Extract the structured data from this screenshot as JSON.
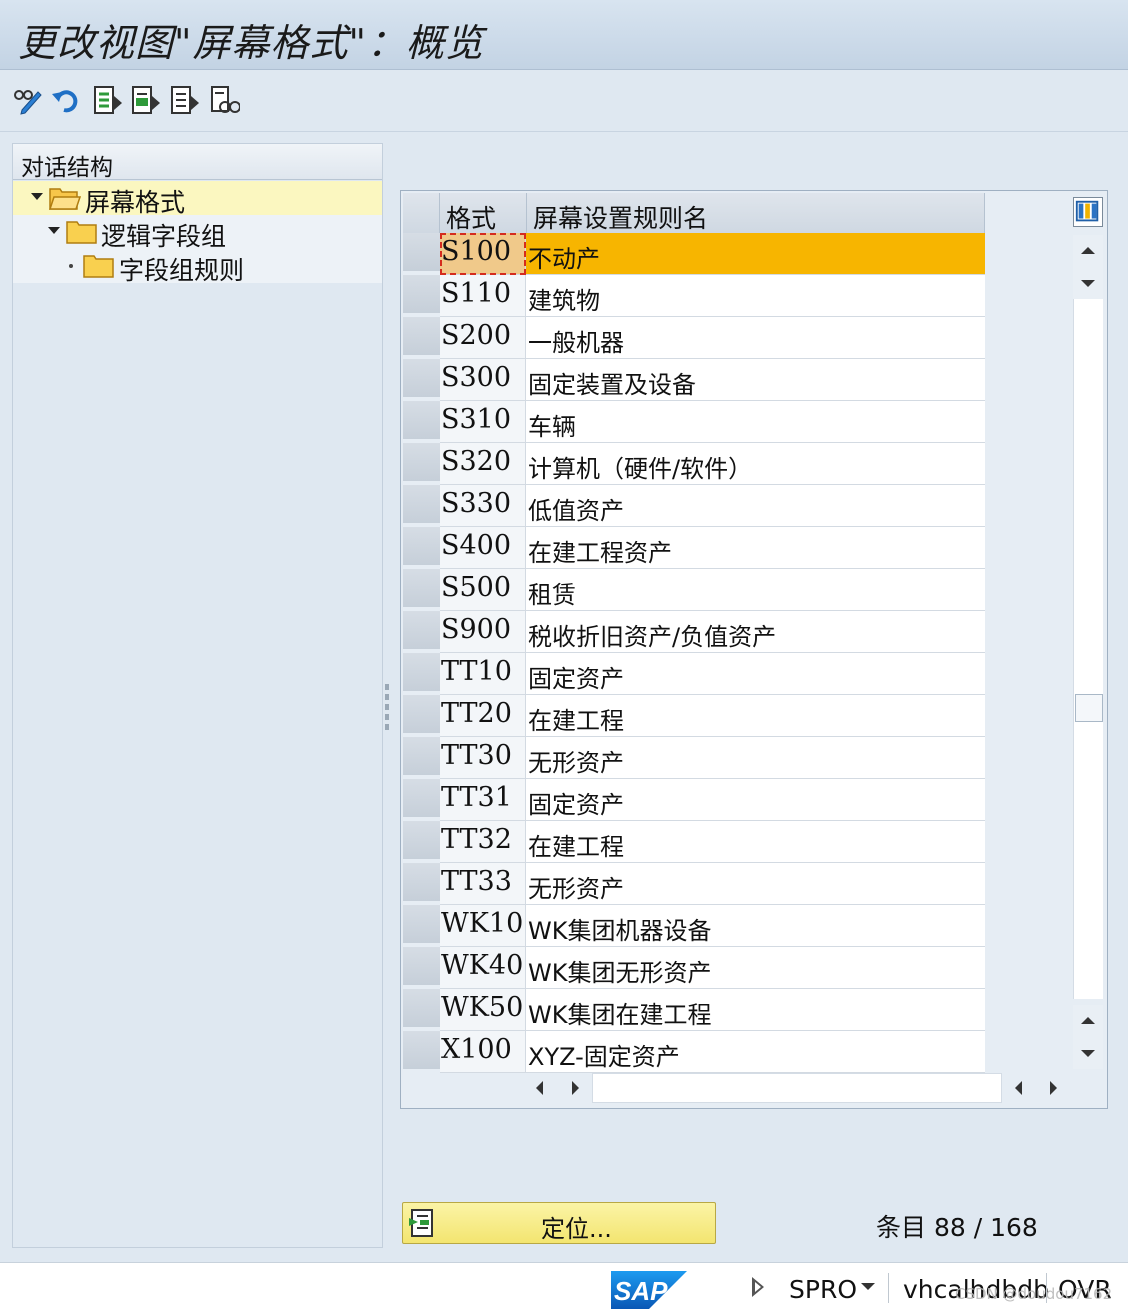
{
  "window": {
    "title": "更改视图\"屏幕格式\"：概览"
  },
  "toolbar": {
    "buttons": [
      {
        "name": "display-change-icon"
      },
      {
        "name": "undo-icon"
      },
      {
        "name": "select-all-icon"
      },
      {
        "name": "select-block-icon"
      },
      {
        "name": "deselect-all-icon"
      },
      {
        "name": "print-icon"
      }
    ]
  },
  "dialog_structure": {
    "header": "对话结构",
    "items": [
      {
        "label": "屏幕格式",
        "level": 0,
        "expanded": true,
        "selected": true
      },
      {
        "label": "逻辑字段组",
        "level": 1,
        "expanded": true,
        "selected": false
      },
      {
        "label": "字段组规则",
        "level": 2,
        "expanded": false,
        "selected": false
      }
    ]
  },
  "table": {
    "columns": [
      "格式",
      "屏幕设置规则名"
    ],
    "rows": [
      {
        "code": "S100",
        "name": "不动产",
        "highlighted": true
      },
      {
        "code": "S110",
        "name": "建筑物"
      },
      {
        "code": "S200",
        "name": "一般机器"
      },
      {
        "code": "S300",
        "name": "固定装置及设备"
      },
      {
        "code": "S310",
        "name": "车辆"
      },
      {
        "code": "S320",
        "name": "计算机（硬件/软件）"
      },
      {
        "code": "S330",
        "name": "低值资产"
      },
      {
        "code": "S400",
        "name": "在建工程资产"
      },
      {
        "code": "S500",
        "name": "租赁"
      },
      {
        "code": "S900",
        "name": "税收折旧资产/负值资产"
      },
      {
        "code": "TT10",
        "name": "固定资产"
      },
      {
        "code": "TT20",
        "name": "在建工程"
      },
      {
        "code": "TT30",
        "name": "无形资产"
      },
      {
        "code": "TT31",
        "name": "固定资产"
      },
      {
        "code": "TT32",
        "name": "在建工程"
      },
      {
        "code": "TT33",
        "name": "无形资产"
      },
      {
        "code": "WK10",
        "name": "WK集团机器设备"
      },
      {
        "code": "WK40",
        "name": "WK集团无形资产"
      },
      {
        "code": "WK50",
        "name": "WK集团在建工程"
      },
      {
        "code": "X100",
        "name": "XYZ-固定资产"
      }
    ]
  },
  "footer": {
    "position_button": "定位...",
    "entries": "条目 88 / 168"
  },
  "statusbar": {
    "logo": "SAP",
    "tcode": "SPRO",
    "server": "vhcalhdbdb",
    "mode": "OVR",
    "watermark": "CSDN @doudou7162"
  },
  "colors": {
    "highlight_row": "#f7b500",
    "selected_tree_item": "#fbf7c0",
    "position_button": "#f3e570",
    "sap_logo": "#0a6ed1"
  }
}
